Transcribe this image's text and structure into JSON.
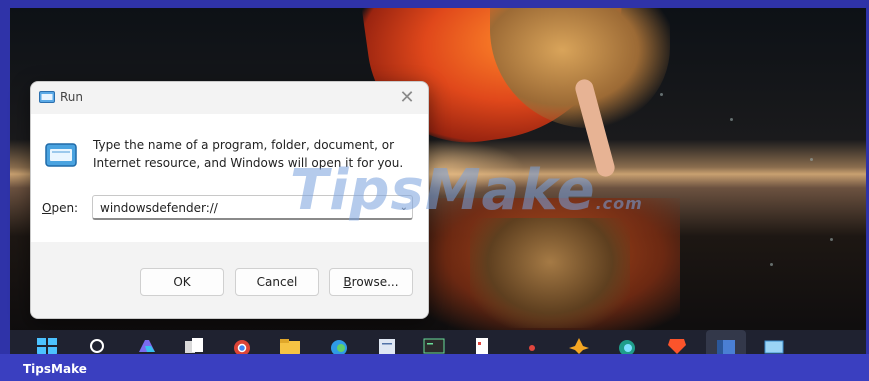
{
  "run_dialog": {
    "title": "Run",
    "close_glyph": "✕",
    "description": "Type the name of a program, folder, document, or Internet resource, and Windows will open it for you.",
    "open_label_mnemonic": "O",
    "open_label_rest": "pen:",
    "open_value": "windowsdefender://",
    "buttons": {
      "ok": "OK",
      "cancel": "Cancel",
      "browse_mnemonic": "B",
      "browse_rest": "rowse..."
    }
  },
  "watermark": {
    "text": "TipsMake",
    "suffix": ".com"
  },
  "taskbar": {
    "icons": [
      "start-icon",
      "search-icon",
      "copilot-icon",
      "task-view-icon",
      "chrome-icon",
      "file-explorer-icon",
      "edge-icon",
      "notepad-icon",
      "terminal-icon",
      "app-icon",
      "paint-icon",
      "photos-icon",
      "edge-dev-icon",
      "brave-icon",
      "word-icon",
      "remote-desktop-icon"
    ]
  },
  "brand_bar": {
    "label": "TipsMake"
  },
  "colors": {
    "frame": "#2f33a8",
    "dialog_bg": "#f3f3f3",
    "accent": "#0067c0"
  }
}
